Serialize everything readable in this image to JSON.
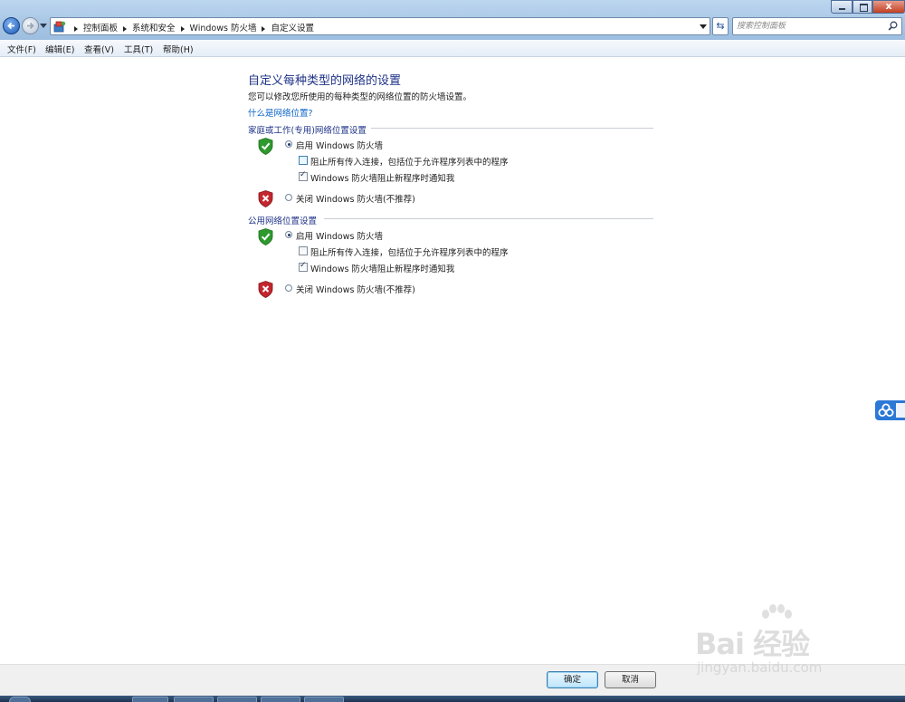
{
  "window": {
    "close_glyph": "x",
    "address": {
      "crumbs": [
        "控制面板",
        "系统和安全",
        "Windows 防火墙",
        "自定义设置"
      ],
      "icon": "control-panel-icon"
    },
    "search": {
      "placeholder": "搜索控制面板",
      "icon": "search-icon"
    }
  },
  "menu": [
    "文件(F)",
    "编辑(E)",
    "查看(V)",
    "工具(T)",
    "帮助(H)"
  ],
  "content": {
    "title": "自定义每种类型的网络的设置",
    "description": "您可以修改您所使用的每种类型的网络位置的防火墙设置。",
    "help_link": "什么是网络位置?",
    "sections": [
      {
        "heading": "家庭或工作(专用)网络位置设置",
        "enable_label": "启用 Windows 防火墙",
        "enable_selected": true,
        "block_all_label": "阻止所有传入连接，包括位于允许程序列表中的程序",
        "block_all_checked": false,
        "notify_label": "Windows 防火墙阻止新程序时通知我",
        "notify_checked": true,
        "disable_label": "关闭 Windows 防火墙(不推荐)",
        "disable_selected": false
      },
      {
        "heading": "公用网络位置设置",
        "enable_label": "启用 Windows 防火墙",
        "enable_selected": true,
        "block_all_label": "阻止所有传入连接，包括位于允许程序列表中的程序",
        "block_all_checked": false,
        "notify_label": "Windows 防火墙阻止新程序时通知我",
        "notify_checked": true,
        "disable_label": "关闭 Windows 防火墙(不推荐)",
        "disable_selected": false
      }
    ]
  },
  "buttons": {
    "ok": "确定",
    "cancel": "取消"
  },
  "watermark": {
    "brand": "Bai 经验",
    "sub": "jingyan.baidu.com"
  },
  "colors": {
    "shield_ok": "#2e9a2e",
    "shield_off": "#c4262e",
    "heading": "#1e3287",
    "link": "#0b63c8"
  }
}
